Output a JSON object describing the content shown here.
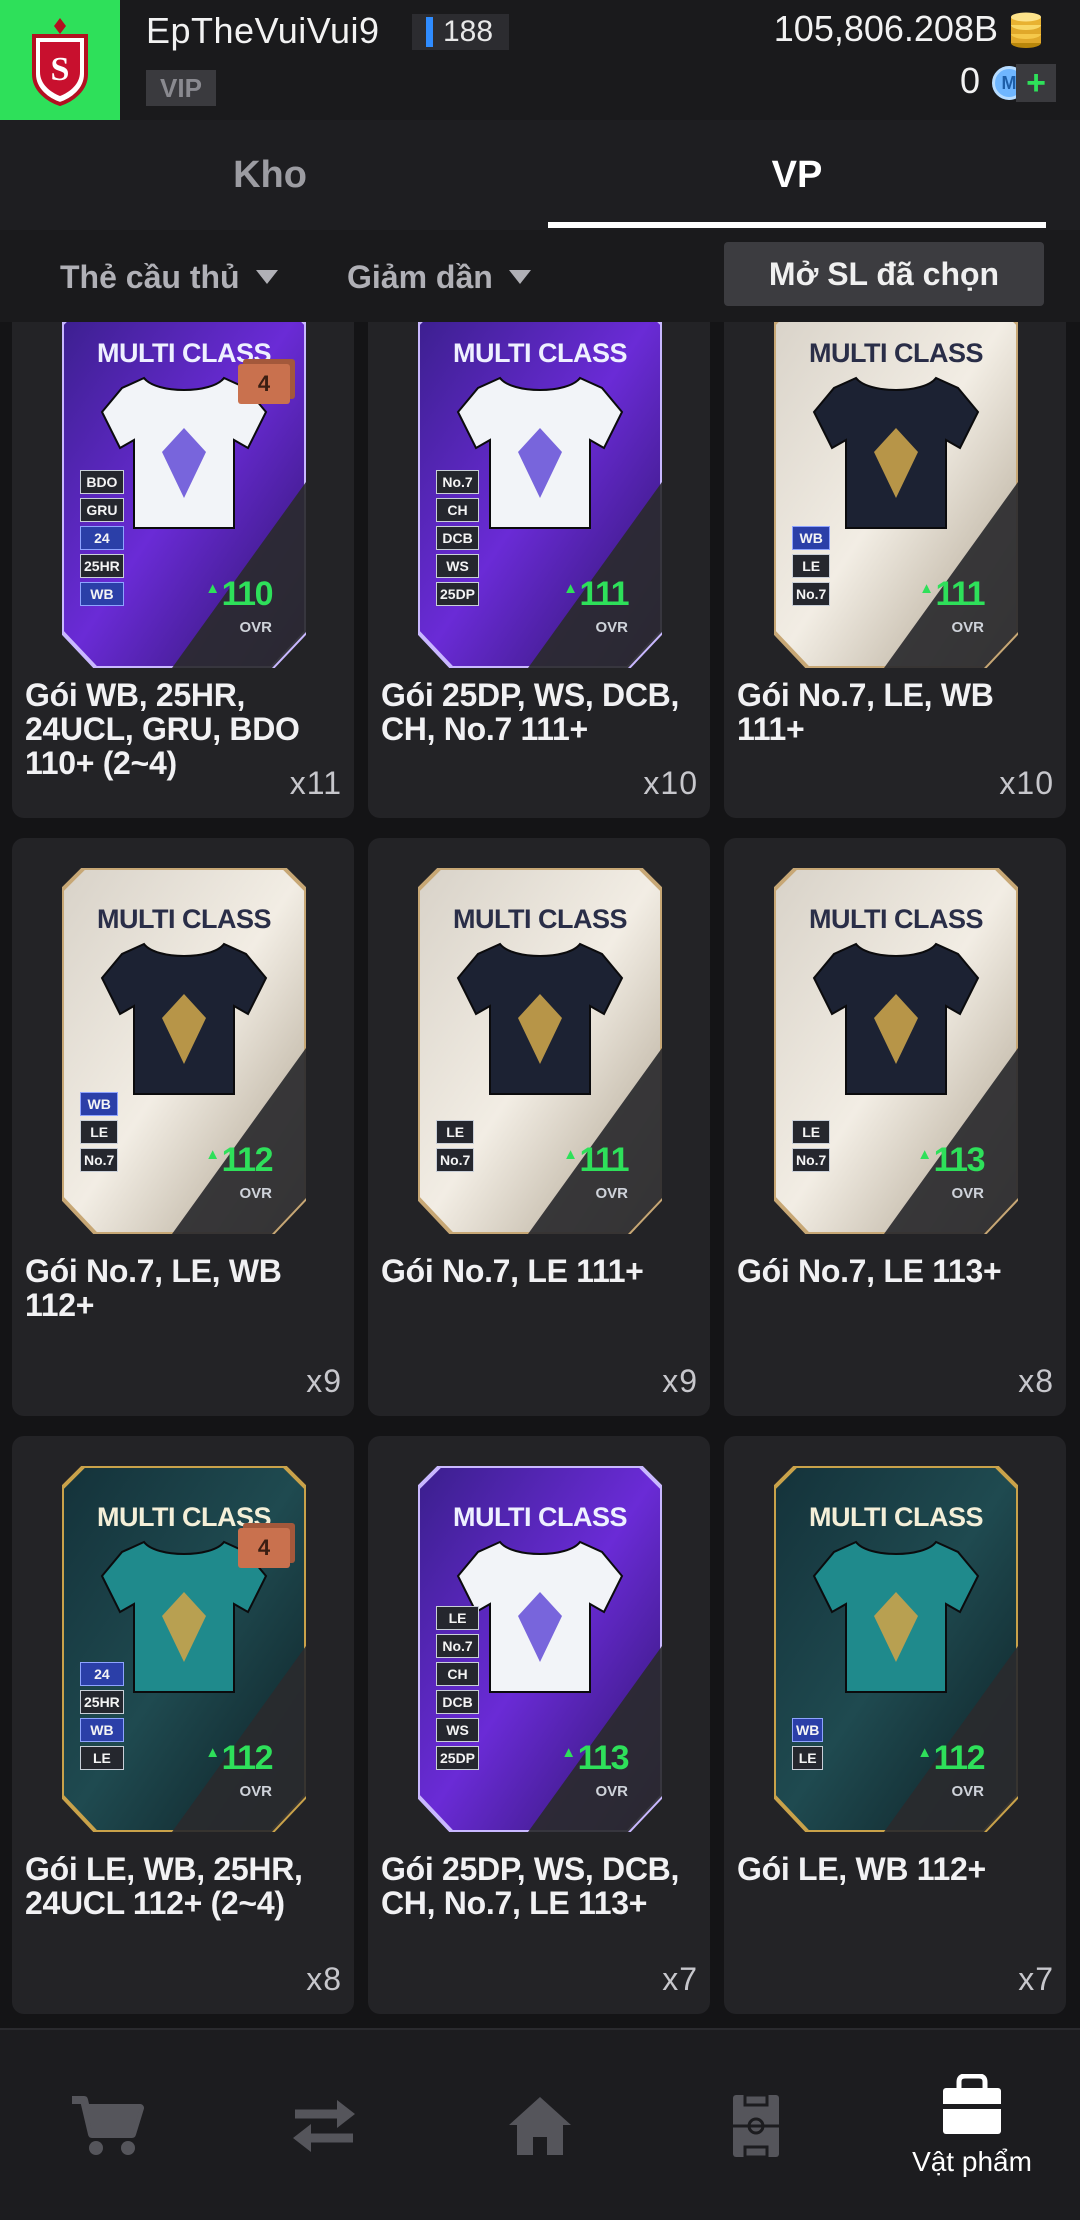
{
  "header": {
    "username": "EpTheVuiVui9",
    "level": "188",
    "vip_label": "VIP",
    "coins": "105,806.208B",
    "m_coins": "0",
    "m_icon_letter": "M",
    "plus_label": "+"
  },
  "tabs": [
    {
      "label": "Kho",
      "active": false
    },
    {
      "label": "VP",
      "active": true
    }
  ],
  "filters": {
    "type_label": "Thẻ cầu thủ",
    "sort_label": "Giảm dần",
    "open_selected_label": "Mở SL đã chọn"
  },
  "items": [
    {
      "title": "Gói WB, 25HR, 24UCL, GRU, BDO 110+ (2~4)",
      "count": "x11",
      "card_label": "MULTI CLASS",
      "ovr": "110",
      "ovr_label": "OVR",
      "qty_badge": "4",
      "style": "purple",
      "shirt": "white",
      "positions": [
        "BDO",
        "GRU",
        "24",
        "25HR",
        "WB"
      ]
    },
    {
      "title": "Gói 25DP, WS, DCB, CH, No.7 111+",
      "count": "x10",
      "card_label": "MULTI CLASS",
      "ovr": "111",
      "ovr_label": "OVR",
      "qty_badge": "",
      "style": "purple",
      "shirt": "white",
      "positions": [
        "No.7",
        "CH",
        "DCB",
        "WS",
        "25DP"
      ]
    },
    {
      "title": "Gói No.7, LE, WB 111+",
      "count": "x10",
      "card_label": "MULTI CLASS",
      "ovr": "111",
      "ovr_label": "OVR",
      "qty_badge": "",
      "style": "silver",
      "shirt": "navy",
      "positions": [
        "WB",
        "LE",
        "No.7"
      ]
    },
    {
      "title": "Gói No.7, LE, WB 112+",
      "count": "x9",
      "card_label": "MULTI CLASS",
      "ovr": "112",
      "ovr_label": "OVR",
      "qty_badge": "",
      "style": "silver",
      "shirt": "navy",
      "positions": [
        "WB",
        "LE",
        "No.7"
      ]
    },
    {
      "title": "Gói No.7, LE 111+",
      "count": "x9",
      "card_label": "MULTI CLASS",
      "ovr": "111",
      "ovr_label": "OVR",
      "qty_badge": "",
      "style": "silver",
      "shirt": "navy",
      "positions": [
        "LE",
        "No.7"
      ]
    },
    {
      "title": "Gói No.7, LE 113+",
      "count": "x8",
      "card_label": "MULTI CLASS",
      "ovr": "113",
      "ovr_label": "OVR",
      "qty_badge": "",
      "style": "silver",
      "shirt": "navy",
      "positions": [
        "LE",
        "No.7"
      ]
    },
    {
      "title": "Gói LE, WB, 25HR, 24UCL 112+ (2~4)",
      "count": "x8",
      "card_label": "MULTI CLASS",
      "ovr": "112",
      "ovr_label": "OVR",
      "qty_badge": "4",
      "style": "dark",
      "shirt": "teal",
      "positions": [
        "24",
        "25HR",
        "WB",
        "LE"
      ]
    },
    {
      "title": "Gói 25DP, WS, DCB, CH, No.7, LE 113+",
      "count": "x7",
      "card_label": "MULTI CLASS",
      "ovr": "113",
      "ovr_label": "OVR",
      "qty_badge": "",
      "style": "purple",
      "shirt": "white",
      "positions": [
        "LE",
        "No.7",
        "CH",
        "DCB",
        "WS",
        "25DP"
      ]
    },
    {
      "title": "Gói LE, WB 112+",
      "count": "x7",
      "card_label": "MULTI CLASS",
      "ovr": "112",
      "ovr_label": "OVR",
      "qty_badge": "",
      "style": "dark",
      "shirt": "teal",
      "positions": [
        "WB",
        "LE"
      ]
    }
  ],
  "bottom_nav": [
    {
      "icon": "cart-icon",
      "label": ""
    },
    {
      "icon": "transfer-icon",
      "label": ""
    },
    {
      "icon": "home-icon",
      "label": ""
    },
    {
      "icon": "pitch-icon",
      "label": ""
    },
    {
      "icon": "bag-icon",
      "label": "Vật phẩm",
      "active": true
    }
  ],
  "colors": {
    "accent_green": "#2ee05a",
    "level_blue": "#2f8cff",
    "background": "#141416",
    "tile": "#232326"
  }
}
